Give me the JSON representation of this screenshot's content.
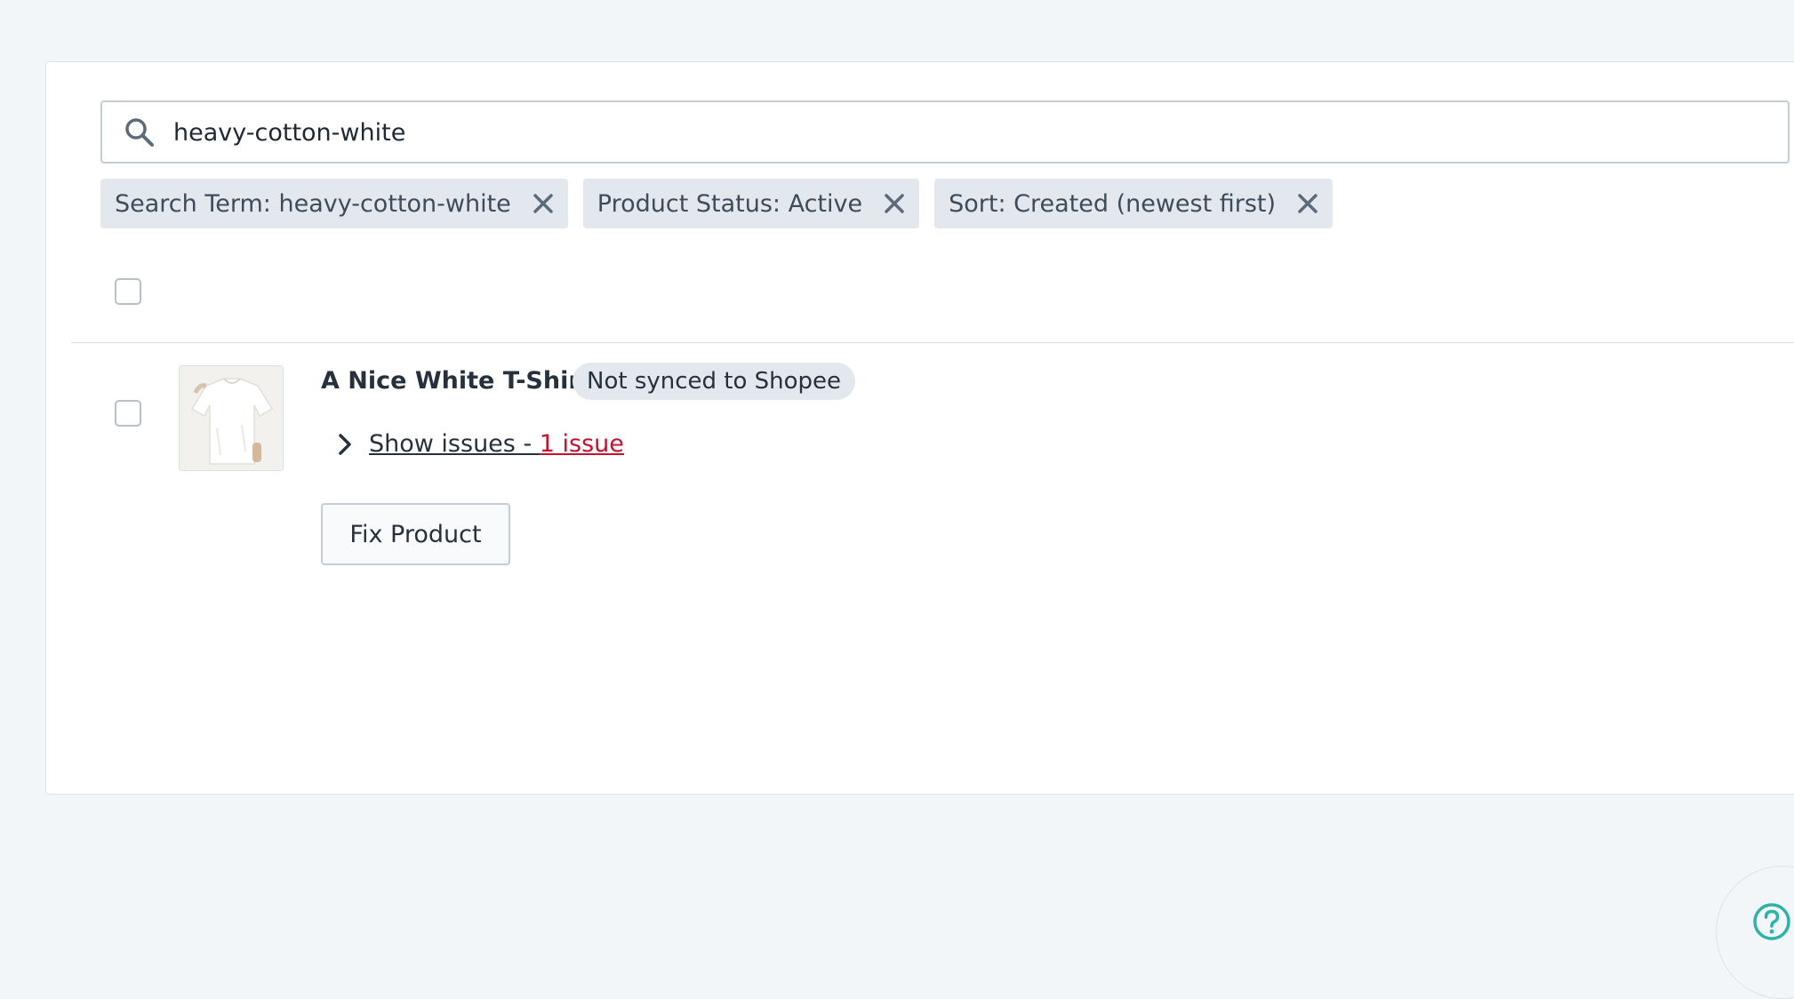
{
  "search": {
    "value": "heavy-cotton-white",
    "icon": "search-icon"
  },
  "filters": [
    {
      "label": "Search Term: heavy-cotton-white"
    },
    {
      "label": "Product Status: Active"
    },
    {
      "label": "Sort: Created (newest first)"
    }
  ],
  "product": {
    "title": "A Nice White T-Shirt",
    "status": "Not synced to Shopee",
    "issues_prefix": "Show issues - ",
    "issues_count": "1 issue",
    "fix_label": "Fix Product"
  },
  "colors": {
    "background": "#f3f6f9",
    "chip": "#e3e8ee",
    "issue_red": "#c8102e",
    "help_teal": "#2bb3a7"
  }
}
